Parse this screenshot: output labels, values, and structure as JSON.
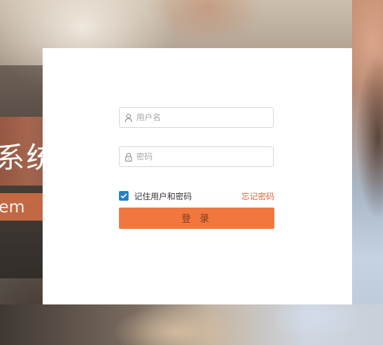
{
  "background": {
    "title_fragment": "系统",
    "subtitle_fragment": "em"
  },
  "login": {
    "username_placeholder": "用户名",
    "username_value": "",
    "password_placeholder": "密码",
    "password_value": "",
    "remember_label": "记住用户和密码",
    "remember_checked": true,
    "forgot_label": "忘记密码",
    "submit_label": "登 录"
  },
  "colors": {
    "accent": "#f2773f",
    "link": "#e0653a",
    "checkbox": "#1f7fd4",
    "card": "#ffffff"
  },
  "icons": {
    "username": "user-icon",
    "password": "lock-icon",
    "checkbox": "check-icon"
  }
}
